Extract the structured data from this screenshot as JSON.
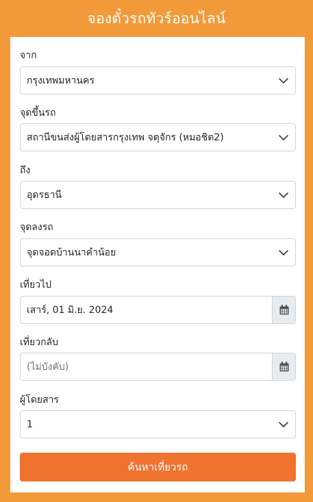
{
  "page_title": "จองตั๋วรถทัวร์ออนไลน์",
  "form": {
    "origin": {
      "label": "จาก",
      "value": "กรุงเทพมหานคร"
    },
    "boarding_point": {
      "label": "จุดขึ้นรถ",
      "value": "สถานีขนส่งผู้โดยสารกรุงเทพ จตุจักร (หมอชิต2)"
    },
    "destination": {
      "label": "ถึง",
      "value": "อุดรธานี"
    },
    "dropoff_point": {
      "label": "จุดลงรถ",
      "value": "จุดจอดบ้านนาคำน้อย"
    },
    "depart_date": {
      "label": "เที่ยวไป",
      "value": "เสาร์, 01 มิ.ย. 2024"
    },
    "return_date": {
      "label": "เที่ยวกลับ",
      "value": "",
      "placeholder": "(ไม่บังคับ)"
    },
    "passengers": {
      "label": "ผู้โดยสาร",
      "value": "1"
    },
    "search_label": "ค้นหาเที่ยวรถ"
  },
  "icons": {
    "select_arrow": "chevron-down-icon",
    "date_picker": "calendar-icon"
  },
  "colors": {
    "background": "#f29a3a",
    "button": "#ef722e",
    "card": "#ffffff"
  }
}
